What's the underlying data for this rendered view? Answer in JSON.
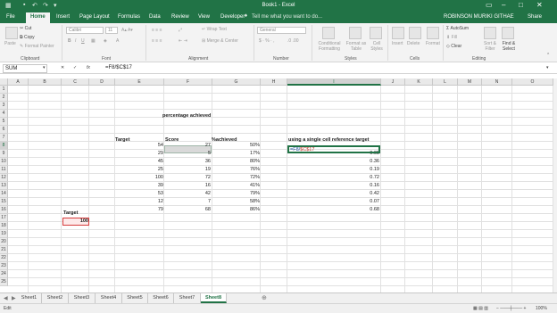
{
  "titlebar": {
    "title": "Book1 - Excel"
  },
  "ribbon_tabs": [
    "File",
    "Home",
    "Insert",
    "Page Layout",
    "Formulas",
    "Data",
    "Review",
    "View",
    "Developer"
  ],
  "tellme": "Tell me what you want to do...",
  "user": "ROBINSON MURIKI GITHAE",
  "share": "Share",
  "ribbon": {
    "clipboard": {
      "paste": "Paste",
      "cut": "Cut",
      "copy": "Copy",
      "format_painter": "Format Painter",
      "label": "Clipboard"
    },
    "font": {
      "name": "Calibri",
      "size": "11",
      "label": "Font"
    },
    "alignment": {
      "wrap": "Wrap Text",
      "merge": "Merge & Center",
      "label": "Alignment"
    },
    "number": {
      "format": "General",
      "label": "Number"
    },
    "styles": {
      "conditional": "Conditional Formatting",
      "format_table": "Format as Table",
      "cell_styles": "Cell Styles",
      "label": "Styles"
    },
    "cells": {
      "insert": "Insert",
      "delete": "Delete",
      "format": "Format",
      "label": "Cells"
    },
    "editing": {
      "autosum": "AutoSum",
      "fill": "Fill",
      "clear": "Clear",
      "sort": "Sort & Filter",
      "find": "Find & Select",
      "label": "Editing"
    }
  },
  "formulabar": {
    "namebox": "SUM",
    "cancel": "✕",
    "enter": "✓",
    "fx": "fx",
    "formula": "=F8/$C$17"
  },
  "columns": [
    "A",
    "B",
    "C",
    "D",
    "E",
    "F",
    "G",
    "H",
    "I",
    "J",
    "K",
    "L",
    "M",
    "N",
    "O"
  ],
  "rows": [
    "1",
    "2",
    "3",
    "4",
    "5",
    "6",
    "7",
    "8",
    "9",
    "10",
    "11",
    "12",
    "13",
    "14",
    "15",
    "16",
    "17",
    "18",
    "19",
    "20",
    "21",
    "22",
    "23",
    "24",
    "25"
  ],
  "cells": {
    "F4": "percentage achieved",
    "E7": "Target",
    "F7": "Score",
    "G7": "%achieved",
    "I7": "using a single cell reference target",
    "E": [
      "54",
      "29",
      "45",
      "25",
      "100",
      "39",
      "53",
      "12",
      "79"
    ],
    "F": [
      "27",
      "5",
      "36",
      "19",
      "72",
      "16",
      "42",
      "7",
      "68"
    ],
    "G": [
      "50%",
      "17%",
      "80%",
      "76%",
      "72%",
      "41%",
      "79%",
      "58%",
      "86%"
    ],
    "I": [
      "0.05",
      "0.36",
      "0.19",
      "0.72",
      "0.16",
      "0.42",
      "0.07",
      "0.68"
    ],
    "C16": "Target",
    "C17": "100",
    "I8_a": "=F8/",
    "I8_b": "$C$17"
  },
  "sheets": [
    "Sheet1",
    "Sheet2",
    "Sheet3",
    "Sheet4",
    "Sheet5",
    "Sheet6",
    "Sheet7",
    "Sheet8"
  ],
  "status": "Edit",
  "zoom": "100%"
}
